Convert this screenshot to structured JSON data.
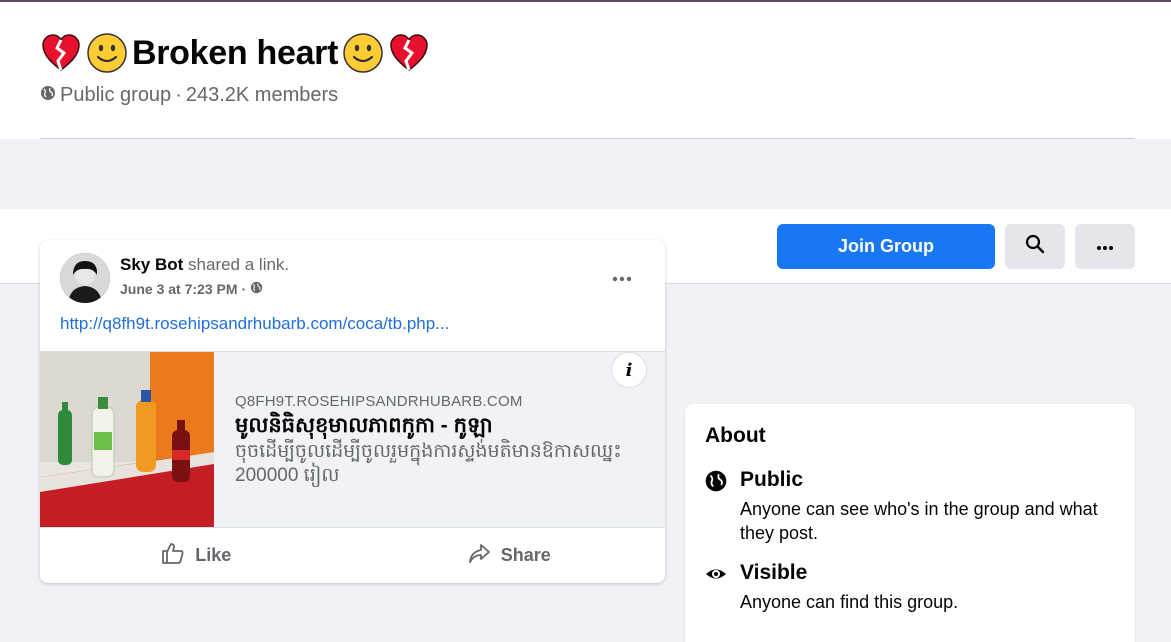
{
  "group": {
    "title": "Broken heart",
    "privacy": "Public group",
    "separator": "·",
    "members": "243.2K members"
  },
  "toolbar": {
    "join_label": "Join Group",
    "search_icon": "search-icon",
    "more_icon": "more-icon"
  },
  "post": {
    "author": "Sky Bot",
    "action": "shared a link.",
    "time": "June 3 at 7:23 PM",
    "time_separator": "·",
    "link_url": "http://q8fh9t.rosehipsandrhubarb.com/coca/tb.php...",
    "preview": {
      "domain": "Q8FH9T.ROSEHIPSANDRHUBARB.COM",
      "title": "មូលនិធិសុខុមាលភាពកូកា - កូឡា",
      "description": "ចុចដើម្បីចូលដើម្បីចូលរួមក្នុងការស្ទង់មតិមានឱកាសឈ្នះ 200000 រៀល",
      "info_label": "i"
    },
    "actions": {
      "like": "Like",
      "share": "Share"
    }
  },
  "about": {
    "title": "About",
    "items": [
      {
        "icon": "globe-icon",
        "name": "Public",
        "desc": "Anyone can see who's in the group and what they post."
      },
      {
        "icon": "eye-icon",
        "name": "Visible",
        "desc": "Anyone can find this group."
      }
    ]
  },
  "colors": {
    "accent": "#1877f2",
    "link": "#216fdb",
    "muted_text": "#65676b",
    "page_bg": "#f0f2f5"
  }
}
